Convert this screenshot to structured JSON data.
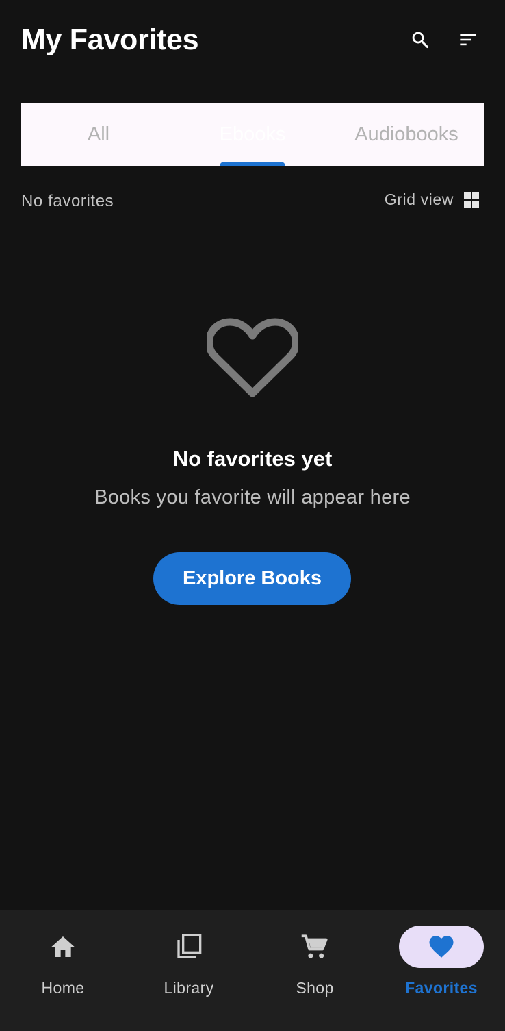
{
  "header": {
    "title": "My Favorites",
    "search_icon": "search-icon",
    "sort_icon": "sort-icon"
  },
  "tabs": [
    {
      "label": "All",
      "selected": false
    },
    {
      "label": "Ebooks",
      "selected": true
    },
    {
      "label": "Audiobooks",
      "selected": false
    }
  ],
  "toolbar": {
    "count_label": "No favorites",
    "view_label": "Grid view",
    "view_icon": "grid-view-icon"
  },
  "empty_state": {
    "icon": "heart-outline-icon",
    "title": "No favorites yet",
    "subtitle": "Books you favorite will appear here",
    "button_label": "Explore Books"
  },
  "bottom_nav": [
    {
      "label": "Home",
      "icon": "home-icon",
      "active": false
    },
    {
      "label": "Library",
      "icon": "library-icon",
      "active": false
    },
    {
      "label": "Shop",
      "icon": "cart-icon",
      "active": false
    },
    {
      "label": "Favorites",
      "icon": "heart-icon",
      "active": true
    }
  ],
  "colors": {
    "background": "#131313",
    "accent": "#1e73d1",
    "nav_background": "#1f1f1f",
    "active_pill": "#e8def8",
    "tab_bar": "#fdf8fd"
  }
}
